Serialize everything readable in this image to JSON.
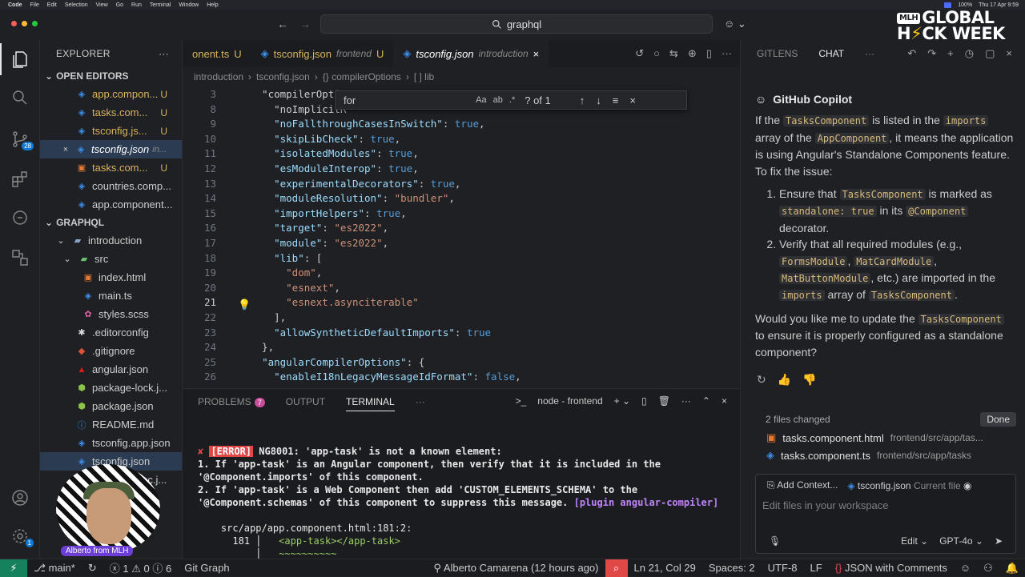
{
  "menubar": {
    "app": "Code",
    "items": [
      "File",
      "Edit",
      "Selection",
      "View",
      "Go",
      "Run",
      "Terminal",
      "Window",
      "Help"
    ],
    "right": "Thu 17 Apr 9:59",
    "battery": "100%"
  },
  "titlebar": {
    "search": "graphql"
  },
  "mlh": {
    "badge": "MLH",
    "line1": "GLOBAL",
    "line2a": "H",
    "line2b": "CK WEEK"
  },
  "activity": {
    "badge": "28",
    "settings_badge": "1"
  },
  "explorer": {
    "title": "EXPLORER",
    "open_editors_title": "OPEN EDITORS",
    "open_editors": [
      {
        "name": "app.compon...",
        "status": "U",
        "icon": "typescript-icon"
      },
      {
        "name": "tasks.com...",
        "status": "U",
        "icon": "typescript-icon"
      },
      {
        "name": "tsconfig.js...",
        "status": "U",
        "icon": "json-icon"
      },
      {
        "name": "tsconfig.json",
        "extra": "in...",
        "icon": "json-icon"
      },
      {
        "name": "tasks.com...",
        "status": "U",
        "icon": "html-icon"
      },
      {
        "name": "countries.comp...",
        "status": "",
        "icon": "typescript-icon"
      },
      {
        "name": "app.component...",
        "status": "",
        "icon": "typescript-icon"
      }
    ],
    "workspace_title": "GRAPHQL",
    "tree": [
      {
        "name": "introduction",
        "indent": 1
      },
      {
        "name": "src",
        "indent": 2
      },
      {
        "name": "index.html",
        "indent": 3
      },
      {
        "name": "main.ts",
        "indent": 3
      },
      {
        "name": "styles.scss",
        "indent": 3
      },
      {
        "name": ".editorconfig",
        "indent": 2
      },
      {
        "name": ".gitignore",
        "indent": 2
      },
      {
        "name": "angular.json",
        "indent": 2
      },
      {
        "name": "package-lock.j...",
        "indent": 2
      },
      {
        "name": "package.json",
        "indent": 2
      },
      {
        "name": "README.md",
        "indent": 2
      },
      {
        "name": "tsconfig.app.json",
        "indent": 2
      },
      {
        "name": "tsconfig.json",
        "indent": 2
      },
      {
        "name": "tsconfig.spec.j...",
        "indent": 2
      }
    ]
  },
  "tabs": [
    {
      "name": "onent.ts",
      "status": "U",
      "dir": ""
    },
    {
      "name": "tsconfig.json",
      "status": "U",
      "dir": "frontend"
    },
    {
      "name": "tsconfig.json",
      "status": "",
      "dir": "introduction"
    }
  ],
  "breadcrumb": [
    "introduction",
    "tsconfig.json",
    "{} compilerOptions",
    "[ ] lib"
  ],
  "find": {
    "query": "for",
    "count": "? of 1"
  },
  "code_lines": [
    {
      "n": "3",
      "t": "  \"compilerOptio"
    },
    {
      "n": "8",
      "t": "    \"noImplicitR"
    },
    {
      "n": "9",
      "t": "    \"noFallthroughCasesInSwitch\": true,"
    },
    {
      "n": "10",
      "t": "    \"skipLibCheck\": true,"
    },
    {
      "n": "11",
      "t": "    \"isolatedModules\": true,"
    },
    {
      "n": "12",
      "t": "    \"esModuleInterop\": true,"
    },
    {
      "n": "13",
      "t": "    \"experimentalDecorators\": true,"
    },
    {
      "n": "14",
      "t": "    \"moduleResolution\": \"bundler\","
    },
    {
      "n": "15",
      "t": "    \"importHelpers\": true,"
    },
    {
      "n": "16",
      "t": "    \"target\": \"es2022\","
    },
    {
      "n": "17",
      "t": "    \"module\": \"es2022\","
    },
    {
      "n": "18",
      "t": "    \"lib\": ["
    },
    {
      "n": "19",
      "t": "      \"dom\","
    },
    {
      "n": "20",
      "t": "      \"esnext\","
    },
    {
      "n": "21",
      "t": "      \"esnext.asynciterable\""
    },
    {
      "n": "22",
      "t": "    ],"
    },
    {
      "n": "23",
      "t": "    \"allowSyntheticDefaultImports\": true"
    },
    {
      "n": "24",
      "t": "  },"
    },
    {
      "n": "25",
      "t": "  \"angularCompilerOptions\": {"
    },
    {
      "n": "26",
      "t": "    \"enableI18nLegacyMessageIdFormat\": false,"
    }
  ],
  "panel": {
    "tabs": {
      "problems": "PROBLEMS",
      "problems_count": "7",
      "output": "OUTPUT",
      "terminal": "TERMINAL"
    },
    "term_name": "node - frontend",
    "error_tag": "[ERROR]",
    "error_line1": " NG8001: 'app-task' is not a known element:",
    "error_line2": "1. If 'app-task' is an Angular component, then verify that it is included in the '@Component.imports' of this component.",
    "error_line3": "2. If 'app-task' is a Web Component then add 'CUSTOM_ELEMENTS_SCHEMA' to the '@Component.schemas' of this component to suppress this message. ",
    "plugin": "[plugin angular-compiler]",
    "loc": "    src/app/app.component.html:181:2:",
    "src_no": "181",
    "src_code": "<app-task></app-task>",
    "squiggle": "~~~~~~~~~~"
  },
  "chat": {
    "tabs": {
      "gitlens": "GITLENS",
      "chat": "CHAT"
    },
    "who": "GitHub Copilot",
    "p1_a": "If the ",
    "p1_code1": "TasksComponent",
    "p1_b": " is listed in the ",
    "p1_code2": "imports",
    "p1_c": " array of the ",
    "p1_code3": "AppComponent",
    "p1_d": ", it means the application is using Angular's Standalone Components feature. To fix the issue:",
    "li1_a": "Ensure that ",
    "li1_code1": "TasksComponent",
    "li1_b": " is marked as ",
    "li1_code2": "standalone: true",
    "li1_c": " in its ",
    "li1_code3": "@Component",
    "li1_d": " decorator.",
    "li2_a": "Verify that all required modules (e.g., ",
    "li2_code1": "FormsModule",
    "li2_b": ", ",
    "li2_code2": "MatCardModule",
    "li2_c": ", ",
    "li2_code3": "MatButtonModule",
    "li2_d": ", etc.) are imported in the ",
    "li2_code4": "imports",
    "li2_e": " array of ",
    "li2_code5": "TasksComponent",
    "li2_f": ".",
    "p2_a": "Would you like me to update the ",
    "p2_code": "TasksComponent",
    "p2_b": " to ensure it is properly configured as a standalone component?",
    "changes_title": "2 files changed",
    "done": "Done",
    "files": [
      {
        "name": "tasks.component.html",
        "path": "frontend/src/app/tas..."
      },
      {
        "name": "tasks.component.ts",
        "path": "frontend/src/app/tasks"
      }
    ],
    "add_context": "Add Context...",
    "ctx_file": "tsconfig.json",
    "ctx_current": "Current file",
    "placeholder": "Edit files in your workspace",
    "mode": "Edit",
    "model": "GPT-4o"
  },
  "status": {
    "branch": "main*",
    "errors": "1",
    "warnings": "0",
    "infos": "6",
    "git_graph": "Git Graph",
    "blame": "Alberto Camarena (12 hours ago)",
    "cursor": "Ln 21, Col 29",
    "spaces": "Spaces: 2",
    "encoding": "UTF-8",
    "eol": "LF",
    "language": "JSON with Comments"
  },
  "webcam": {
    "label": "Alberto from MLH"
  }
}
